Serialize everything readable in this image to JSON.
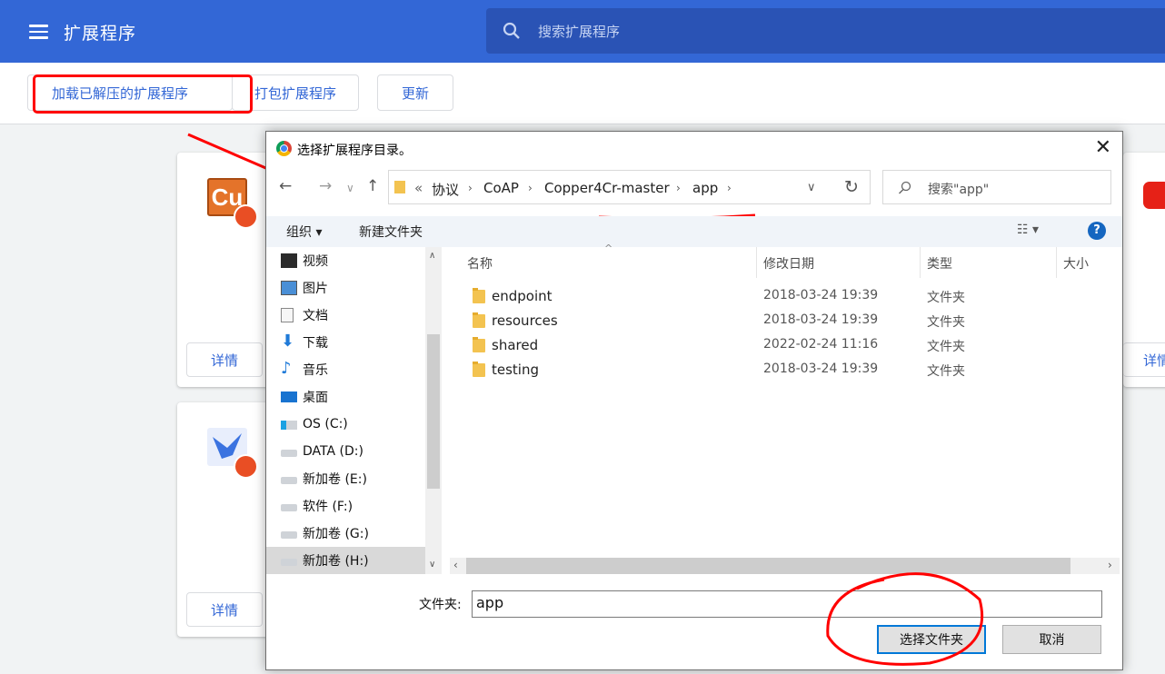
{
  "app": {
    "title": "扩展程序"
  },
  "search": {
    "placeholder": "搜索扩展程序"
  },
  "toolbar": {
    "load_unpacked": "加载已解压的扩展程序",
    "pack": "打包扩展程序",
    "update": "更新"
  },
  "cards": {
    "details": "详情",
    "cu_label": "Cu"
  },
  "dialog": {
    "title": "选择扩展程序目录。",
    "breadcrumbs": [
      "«",
      "协议",
      "CoAP",
      "Copper4Cr-master",
      "app"
    ],
    "search_placeholder": "搜索\"app\"",
    "organize": "组织 ▾",
    "new_folder": "新建文件夹",
    "help": "?",
    "nav_items": [
      "视频",
      "图片",
      "文档",
      "下载",
      "音乐",
      "桌面",
      "OS (C:)",
      "DATA (D:)",
      "新加卷 (E:)",
      "软件 (F:)",
      "新加卷 (G:)",
      "新加卷 (H:)"
    ],
    "columns": {
      "name": "名称",
      "date": "修改日期",
      "type": "类型",
      "size": "大小"
    },
    "files": [
      {
        "name": "endpoint",
        "date": "2018-03-24 19:39",
        "type": "文件夹"
      },
      {
        "name": "resources",
        "date": "2018-03-24 19:39",
        "type": "文件夹"
      },
      {
        "name": "shared",
        "date": "2022-02-24 11:16",
        "type": "文件夹"
      },
      {
        "name": "testing",
        "date": "2018-03-24 19:39",
        "type": "文件夹"
      }
    ],
    "folder_label": "文件夹:",
    "folder_value": "app",
    "select_folder": "选择文件夹",
    "cancel": "取消"
  }
}
